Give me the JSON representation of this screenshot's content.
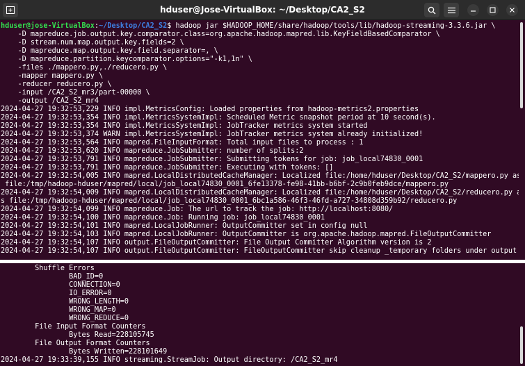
{
  "window": {
    "title": "hduser@Jose-VirtualBox: ~/Desktop/CA2_S2"
  },
  "top_pane": {
    "prompt_user": "hduser@jose-VirtualBox",
    "prompt_sep": ":",
    "prompt_path": "~/Desktop/CA2_S2",
    "prompt_symbol": "$ ",
    "command": "hadoop jar $HADOOP_HOME/share/hadoop/tools/lib/hadoop-streaming-3.3.6.jar \\",
    "lines": [
      "    -D mapreduce.job.output.key.comparator.class=org.apache.hadoop.mapred.lib.KeyFieldBasedComparator \\",
      "    -D stream.num.map.output.key.fields=2 \\",
      "    -D mapreduce.map.output.key.field.separator=, \\",
      "    -D mapreduce.partition.keycomparator.options=\"-k1,1n\" \\",
      "    -files ./mappero.py,./reducero.py \\",
      "    -mapper mappero.py \\",
      "    -reducer reducero.py \\",
      "    -input /CA2_S2_mr3/part-00000 \\",
      "    -output /CA2_S2_mr4",
      "2024-04-27 19:32:53,229 INFO impl.MetricsConfig: Loaded properties from hadoop-metrics2.properties",
      "2024-04-27 19:32:53,354 INFO impl.MetricsSystemImpl: Scheduled Metric snapshot period at 10 second(s).",
      "2024-04-27 19:32:53,354 INFO impl.MetricsSystemImpl: JobTracker metrics system started",
      "2024-04-27 19:32:53,374 WARN impl.MetricsSystemImpl: JobTracker metrics system already initialized!",
      "2024-04-27 19:32:53,564 INFO mapred.FileInputFormat: Total input files to process : 1",
      "2024-04-27 19:32:53,620 INFO mapreduce.JobSubmitter: number of splits:2",
      "2024-04-27 19:32:53,791 INFO mapreduce.JobSubmitter: Submitting tokens for job: job_local74830_0001",
      "2024-04-27 19:32:53,791 INFO mapreduce.JobSubmitter: Executing with tokens: []",
      "2024-04-27 19:32:54,005 INFO mapred.LocalDistributedCacheManager: Localized file:/home/hduser/Desktop/CA2_S2/mappero.py as",
      " file:/tmp/hadoop-hduser/mapred/local/job_local74830_0001_6fe13378-fe98-41bb-b6bf-2c9b0feb9dce/mappero.py",
      "2024-04-27 19:32:54,009 INFO mapred.LocalDistributedCacheManager: Localized file:/home/hduser/Desktop/CA2_S2/reducero.py a",
      "s file:/tmp/hadoop-hduser/mapred/local/job_local74830_0001_6bc1a586-46f3-46fd-a727-34808d359b92/reducero.py",
      "2024-04-27 19:32:54,099 INFO mapreduce.Job: The url to track the job: http://localhost:8080/",
      "2024-04-27 19:32:54,100 INFO mapreduce.Job: Running job: job_local74830_0001",
      "2024-04-27 19:32:54,101 INFO mapred.LocalJobRunner: OutputCommitter set in config null",
      "2024-04-27 19:32:54,103 INFO mapred.LocalJobRunner: OutputCommitter is org.apache.hadoop.mapred.FileOutputCommitter",
      "2024-04-27 19:32:54,107 INFO output.FileOutputCommitter: File Output Committer Algorithm version is 2",
      "2024-04-27 19:32:54,107 INFO output.FileOutputCommitter: FileOutputCommitter skip cleanup _temporary folders under output"
    ]
  },
  "bottom_pane": {
    "lines": [
      "        Shuffle Errors",
      "                BAD_ID=0",
      "                CONNECTION=0",
      "                IO_ERROR=0",
      "                WRONG_LENGTH=0",
      "                WRONG_MAP=0",
      "                WRONG_REDUCE=0",
      "        File Input Format Counters",
      "                Bytes Read=228105745",
      "        File Output Format Counters",
      "                Bytes Written=228101649",
      "2024-04-27 19:33:39,155 INFO streaming.StreamJob: Output directory: /CA2_S2_mr4"
    ]
  }
}
